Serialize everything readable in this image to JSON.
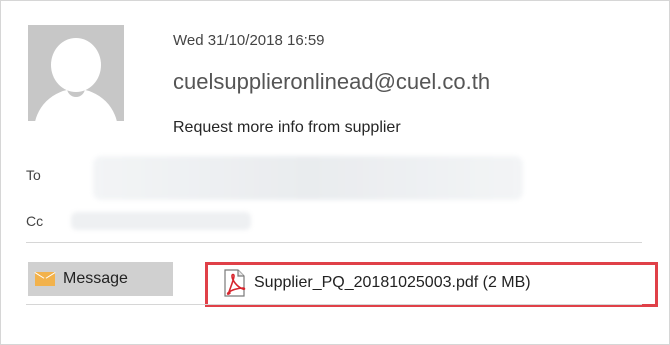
{
  "email": {
    "date": "Wed 31/10/2018 16:59",
    "from": "cuelsupplieronlinead@cuel.co.th",
    "subject": "Request more info from supplier",
    "to_label": "To",
    "cc_label": "Cc"
  },
  "tabs": {
    "message_label": "Message"
  },
  "attachment": {
    "filename": "Supplier_PQ_20181025003.pdf (2 MB)",
    "icon": "pdf-icon"
  },
  "colors": {
    "highlight_border": "#e04048",
    "message_tab_bg": "#d0d0d0",
    "envelope": "#f2b24c",
    "avatar_bg": "#c7c7c7"
  }
}
